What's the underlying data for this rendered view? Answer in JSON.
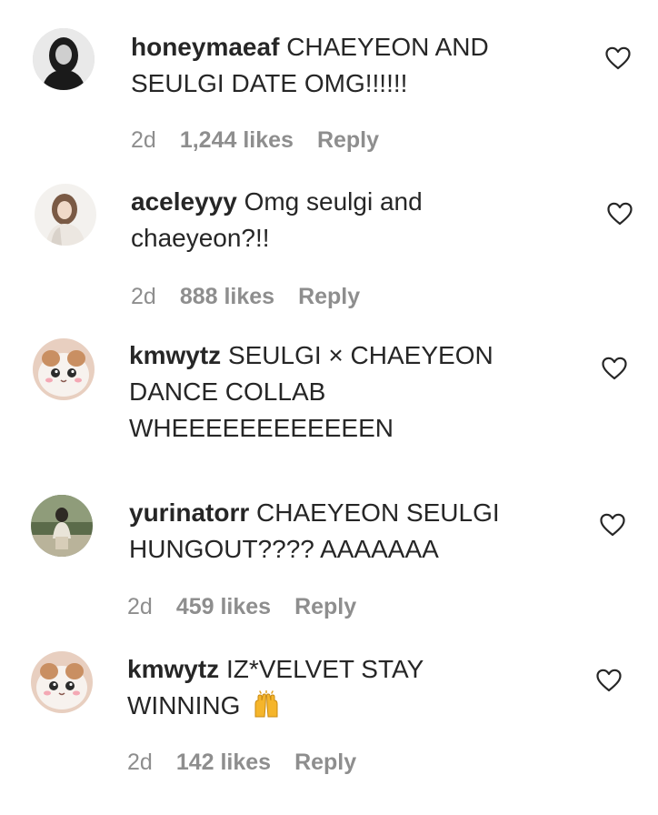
{
  "comments": [
    {
      "username": "honeymaeaf",
      "text": "CHAEYEON AND SEULGI DATE OMG!!!!!!",
      "time": "2d",
      "likes": "1,244 likes",
      "reply": "Reply",
      "avatar_icon": "person-photo-icon",
      "like_icon": "heart-outline-icon"
    },
    {
      "username": "aceleyyy",
      "text": "Omg seulgi and chaeyeon?!!",
      "time": "2d",
      "likes": "888 likes",
      "reply": "Reply",
      "avatar_icon": "person-photo-icon",
      "like_icon": "heart-outline-icon"
    },
    {
      "username": "kmwytz",
      "text": "SEULGI × CHAEYEON DANCE COLLAB WHEEEEEEEEEEEEN",
      "avatar_icon": "cat-photo-icon",
      "like_icon": "heart-outline-icon"
    },
    {
      "username": "yurinatorr",
      "text": "CHAEYEON SEULGI HUNGOUT???? AAAAAAA",
      "time": "2d",
      "likes": "459 likes",
      "reply": "Reply",
      "avatar_icon": "person-photo-icon",
      "like_icon": "heart-outline-icon"
    },
    {
      "username": "kmwytz",
      "text": "IZ*VELVET STAY WINNING",
      "emoji": "raising-hands-emoji",
      "time": "2d",
      "likes": "142 likes",
      "reply": "Reply",
      "avatar_icon": "cat-photo-icon",
      "like_icon": "heart-outline-icon"
    }
  ],
  "colors": {
    "text": "#262626",
    "meta": "#8e8e8e",
    "background": "#ffffff"
  }
}
